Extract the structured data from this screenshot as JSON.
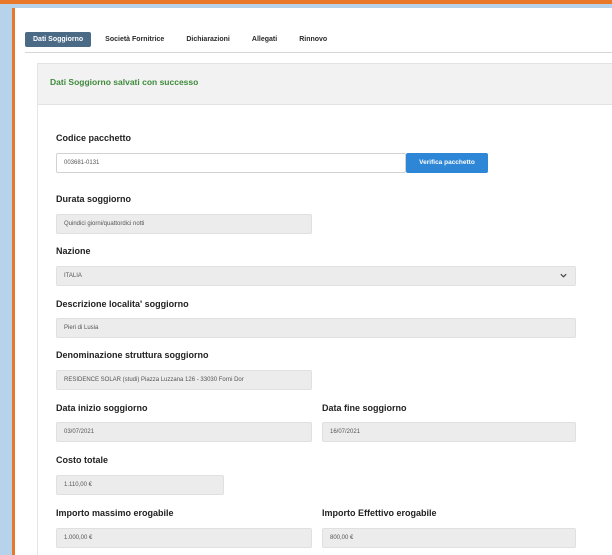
{
  "tabs": [
    {
      "label": "Dati Soggiorno",
      "active": true
    },
    {
      "label": "Società Fornitrice",
      "active": false
    },
    {
      "label": "Dichiarazioni",
      "active": false
    },
    {
      "label": "Allegati",
      "active": false
    },
    {
      "label": "Rinnovo",
      "active": false
    }
  ],
  "alert": {
    "message": "Dati Soggiorno salvati con successo"
  },
  "form": {
    "codice_pacchetto": {
      "label": "Codice pacchetto",
      "value": "003681-0131"
    },
    "verify_button": "Verifica pacchetto",
    "durata": {
      "label": "Durata soggiorno",
      "value": "Quindici giorni/quattordici notti"
    },
    "nazione": {
      "label": "Nazione",
      "value": "ITALIA"
    },
    "descrizione": {
      "label": "Descrizione localita' soggiorno",
      "value": "Pieri di Lusia"
    },
    "struttura": {
      "label": "Denominazione struttura soggiorno",
      "value": "RESIDENCE SOLAR (studi) Piazza Luzzana 126 - 33030 Forni Dor"
    },
    "data_inizio": {
      "label": "Data inizio soggiorno",
      "value": "03/07/2021"
    },
    "data_fine": {
      "label": "Data fine soggiorno",
      "value": "16/07/2021"
    },
    "costo": {
      "label": "Costo totale",
      "value": "1.110,00 €"
    },
    "importo_max": {
      "label": "Importo massimo erogabile",
      "value": "1.000,00 €"
    },
    "importo_eff": {
      "label": "Importo Effettivo erogabile",
      "value": "800,00 €"
    }
  },
  "colors": {
    "accent": "#e8782a",
    "primary_button": "#2d86d6",
    "success": "#3e8a3a"
  }
}
